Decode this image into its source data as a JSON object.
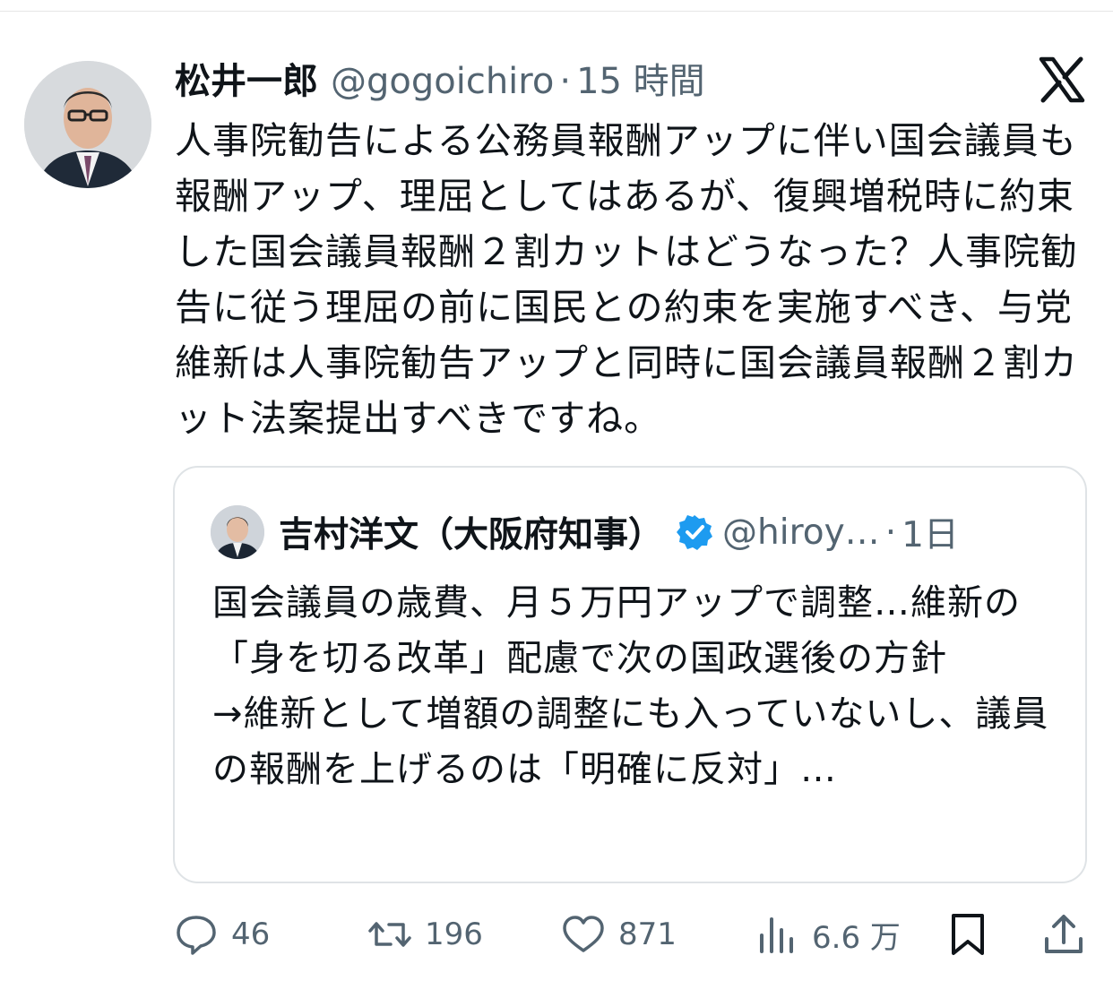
{
  "tweet": {
    "author_name": "松井一郎",
    "handle": "@gogoichiro",
    "separator": "·",
    "time": "15 時間",
    "text": "人事院勧告による公務員報酬アップに伴い国会議員も報酬アップ、理屈としてはあるが、復興増税時に約束した国会議員報酬２割カットはどうなった？人事院勧告に従う理屈の前に国民との約束を実施すべき、与党維新は人事院勧告アップと同時に国会議員報酬２割カット法案提出すべきですね。"
  },
  "quote": {
    "author_name": "吉村洋文（大阪府知事）",
    "handle": "@hiroy…",
    "separator": "·",
    "time": "1日",
    "text": "国会議員の歳費、月５万円アップで調整…維新の「身を切る改革」配慮で次の国政選後の方針\n→維新として増額の調整にも入っていないし、議員の報酬を上げるのは「明確に反対」…"
  },
  "actions": {
    "replies": "46",
    "retweets": "196",
    "likes": "871",
    "views": "6.6 万"
  },
  "icons": {
    "brand_logo": "x-logo-icon",
    "verified": "verified-badge-icon",
    "reply": "reply-icon",
    "retweet": "retweet-icon",
    "like": "heart-icon",
    "views": "views-chart-icon",
    "bookmark": "bookmark-icon",
    "share": "share-icon"
  },
  "colors": {
    "text": "#0f1419",
    "secondary": "#536471",
    "verified": "#1d9bf0",
    "border": "#dfe3e6"
  }
}
